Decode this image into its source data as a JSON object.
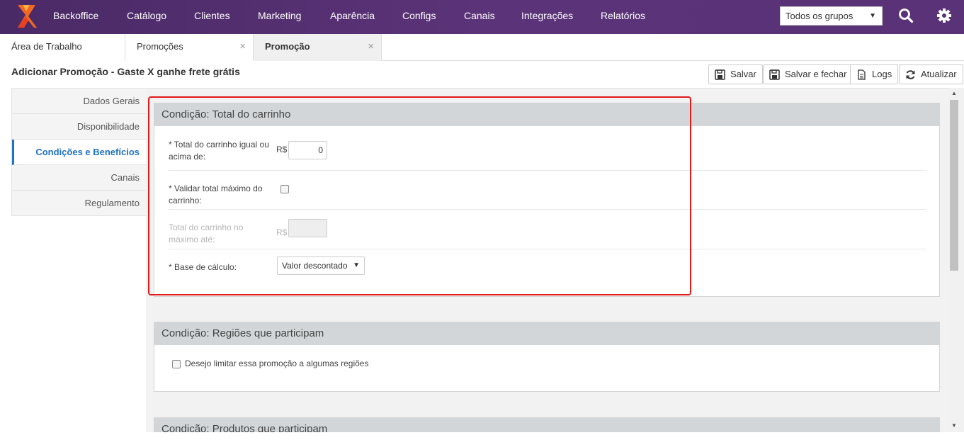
{
  "nav": {
    "items": [
      "Backoffice",
      "Catálogo",
      "Clientes",
      "Marketing",
      "Aparência",
      "Configs",
      "Canais",
      "Integrações",
      "Relatórios"
    ],
    "group_select": "Todos os grupos"
  },
  "tabs": [
    {
      "label": "Área de Trabalho"
    },
    {
      "label": "Promoções",
      "close": "×"
    },
    {
      "label": "Promoção",
      "close": "×"
    }
  ],
  "header": {
    "title": "Adicionar Promoção - Gaste X ganhe frete grátis",
    "buttons": {
      "save": "Salvar",
      "save_close": "Salvar e fechar",
      "logs": "Logs",
      "refresh": "Atualizar"
    }
  },
  "leftmenu": [
    "Dados Gerais",
    "Disponibilidade",
    "Condições e Benefícios",
    "Canais",
    "Regulamento"
  ],
  "panels": {
    "cart_total": {
      "title": "Condição: Total do carrinho",
      "min_label": "* Total do carrinho igual ou acima de:",
      "currency": "R$",
      "min_value": "0",
      "validate_max_label": "* Validar total máximo do carrinho:",
      "max_label": "Total do carrinho no máximo até:",
      "max_value": "",
      "base_label": "* Base de cálculo:",
      "base_value": "Valor descontado"
    },
    "regions": {
      "title": "Condição: Regiões que participam",
      "limit_label": "Desejo limitar essa promoção a algumas regiões"
    },
    "products": {
      "title": "Condição: Produtos que participam"
    }
  }
}
